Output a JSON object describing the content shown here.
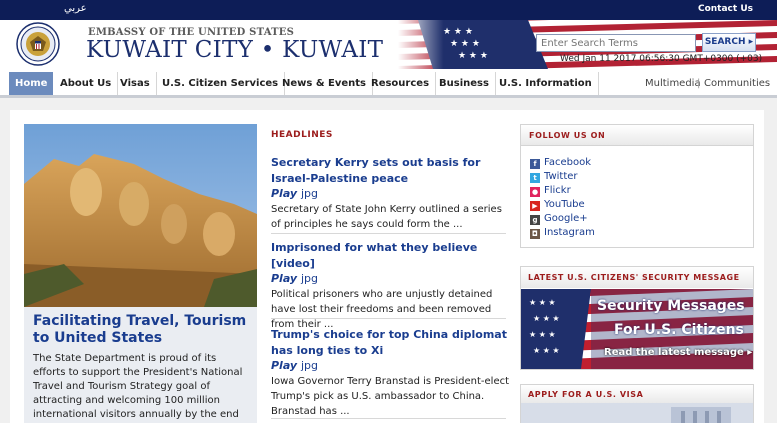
{
  "topbar": {
    "arabic": "عربي",
    "contact": "Contact Us"
  },
  "header": {
    "embassy_line": "EMBASSY OF THE UNITED STATES",
    "city_line": "KUWAIT CITY • KUWAIT",
    "search_placeholder": "Enter Search Terms",
    "search_button": "SEARCH ▸",
    "datetime": "Wed Jan 11 2017 06:56:30 GMT+0300 (+03)"
  },
  "nav": {
    "items": [
      "Home",
      "About Us",
      "Visas",
      "U.S. Citizen Services",
      "News & Events",
      "Resources",
      "Business",
      "U.S. Information"
    ],
    "side": [
      "Multimedia",
      "Communities"
    ],
    "active": "Home"
  },
  "feature": {
    "title": "Facilitating Travel, Tourism to United States",
    "body": "The State Department is proud of its efforts to support the President's National Travel and Tourism Strategy goal of attracting and welcoming 100 million international visitors annually by the end of"
  },
  "headlines": {
    "label": "HEADLINES",
    "stories": [
      {
        "title": "Secretary Kerry sets out basis for Israel-Palestine peace",
        "play": "Play",
        "jpg": "jpg",
        "desc": "Secretary of State John Kerry outlined a series of principles he says could form the ..."
      },
      {
        "title": "Imprisoned for what they believe [video]",
        "play": "Play",
        "jpg": "jpg",
        "desc": "Political prisoners who are unjustly detained have lost their freedoms and been removed from their ..."
      },
      {
        "title": "Trump's choice for top China diplomat has long ties to Xi",
        "play": "Play",
        "jpg": "jpg",
        "desc": "Iowa Governor Terry Branstad is President-elect Trump's pick as U.S. ambassador to China. Branstad has ..."
      }
    ]
  },
  "follow": {
    "heading": "FOLLOW US ON",
    "items": [
      {
        "label": "Facebook",
        "icon": "facebook-icon",
        "color": "#3b5998",
        "glyph": "f"
      },
      {
        "label": "Twitter",
        "icon": "twitter-icon",
        "color": "#33a7e0",
        "glyph": "t"
      },
      {
        "label": "Flickr",
        "icon": "flickr-icon",
        "color": "#e0245e",
        "glyph": "●"
      },
      {
        "label": "YouTube",
        "icon": "youtube-icon",
        "color": "#d8261f",
        "glyph": "▶"
      },
      {
        "label": "Google+",
        "icon": "googleplus-icon",
        "color": "#444444",
        "glyph": "g"
      },
      {
        "label": "Instagram",
        "icon": "instagram-icon",
        "color": "#6b5646",
        "glyph": "◘"
      }
    ]
  },
  "security": {
    "heading": "LATEST U.S. CITIZENS' SECURITY MESSAGE",
    "line1": "Security Messages",
    "line2": "For U.S. Citizens",
    "link": "Read the latest message ▸"
  },
  "visa": {
    "heading": "APPLY FOR A U.S. VISA"
  },
  "colors": {
    "topbar": "#0d1d57",
    "link": "#1a3d8f",
    "section_heading": "#9c1c1c",
    "active_nav": "#6c8bbd"
  }
}
